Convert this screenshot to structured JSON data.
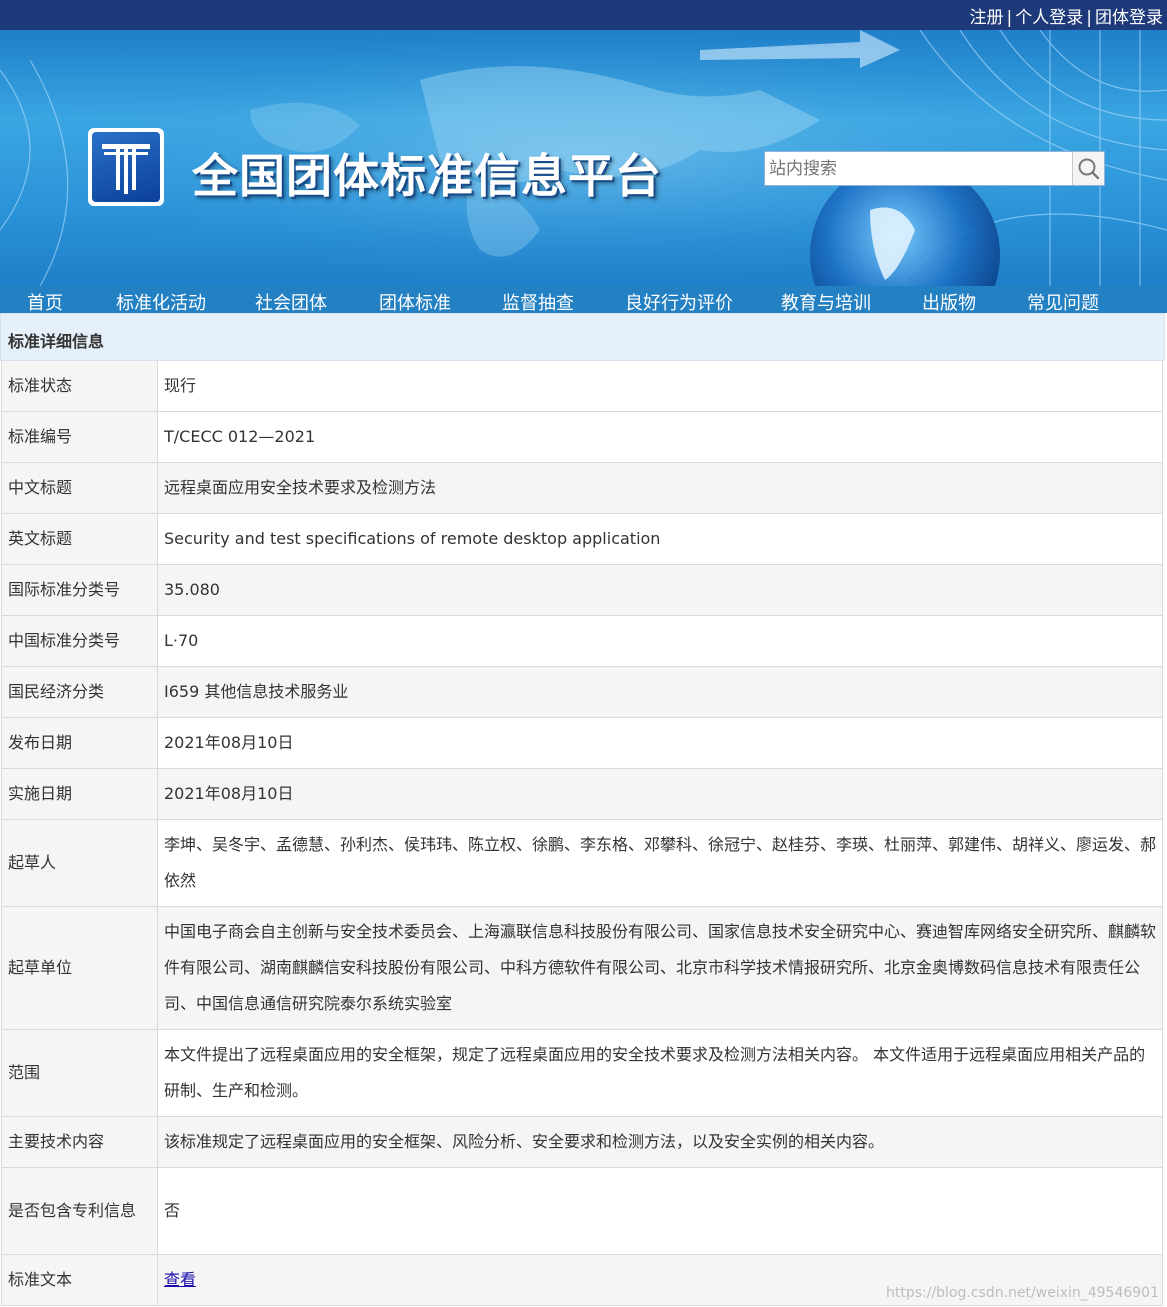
{
  "topbar": {
    "register": "注册",
    "personal_login": "个人登录",
    "group_login": "团体登录",
    "separator": "|"
  },
  "header": {
    "site_title": "全国团体标准信息平台",
    "logo_icon": "platform-logo-icon",
    "search_placeholder": "站内搜索",
    "search_icon": "search-icon"
  },
  "nav": {
    "items": [
      "首页",
      "标准化活动",
      "社会团体",
      "团体标准",
      "监督抽查",
      "良好行为评价",
      "教育与培训",
      "出版物",
      "常见问题"
    ]
  },
  "panel": {
    "title": "标准详细信息"
  },
  "details": [
    {
      "label": "标准状态",
      "value": "现行"
    },
    {
      "label": "标准编号",
      "value": "T/CECC 012—2021"
    },
    {
      "label": "中文标题",
      "value": "远程桌面应用安全技术要求及检测方法"
    },
    {
      "label": "英文标题",
      "value": "Security and test specifications of remote desktop application"
    },
    {
      "label": "国际标准分类号",
      "value": "35.080"
    },
    {
      "label": "中国标准分类号",
      "value": "L·70"
    },
    {
      "label": "国民经济分类",
      "value": "I659 其他信息技术服务业"
    },
    {
      "label": "发布日期",
      "value": "2021年08月10日"
    },
    {
      "label": "实施日期",
      "value": "2021年08月10日"
    },
    {
      "label": "起草人",
      "value": "李坤、吴冬宇、孟德慧、孙利杰、侯玮玮、陈立权、徐鹏、李东格、邓攀科、徐冠宁、赵桂芬、李瑛、杜丽萍、郭建伟、胡祥义、廖运发、郝依然"
    },
    {
      "label": "起草单位",
      "value": "中国电子商会自主创新与安全技术委员会、上海瀛联信息科技股份有限公司、国家信息技术安全研究中心、赛迪智库网络安全研究所、麒麟软件有限公司、湖南麒麟信安科技股份有限公司、中科方德软件有限公司、北京市科学技术情报研究所、北京金奥博数码信息技术有限责任公司、中国信息通信研究院泰尔系统实验室"
    },
    {
      "label": "范围",
      "value": "本文件提出了远程桌面应用的安全框架，规定了远程桌面应用的安全技术要求及检测方法相关内容。 本文件适用于远程桌面应用相关产品的研制、生产和检测。"
    },
    {
      "label": "主要技术内容",
      "value": "该标准规定了远程桌面应用的安全框架、风险分析、安全要求和检测方法，以及安全实例的相关内容。"
    },
    {
      "label": "是否包含专利信息",
      "value": "否"
    },
    {
      "label": "标准文本",
      "value": "查看"
    }
  ],
  "watermark": "https://blog.csdn.net/weixin_49546901",
  "colors": {
    "topbar": "#1e3a7a",
    "nav": "#2380c2",
    "panel_head": "#e6f0fa",
    "link": "#1a0dab"
  }
}
